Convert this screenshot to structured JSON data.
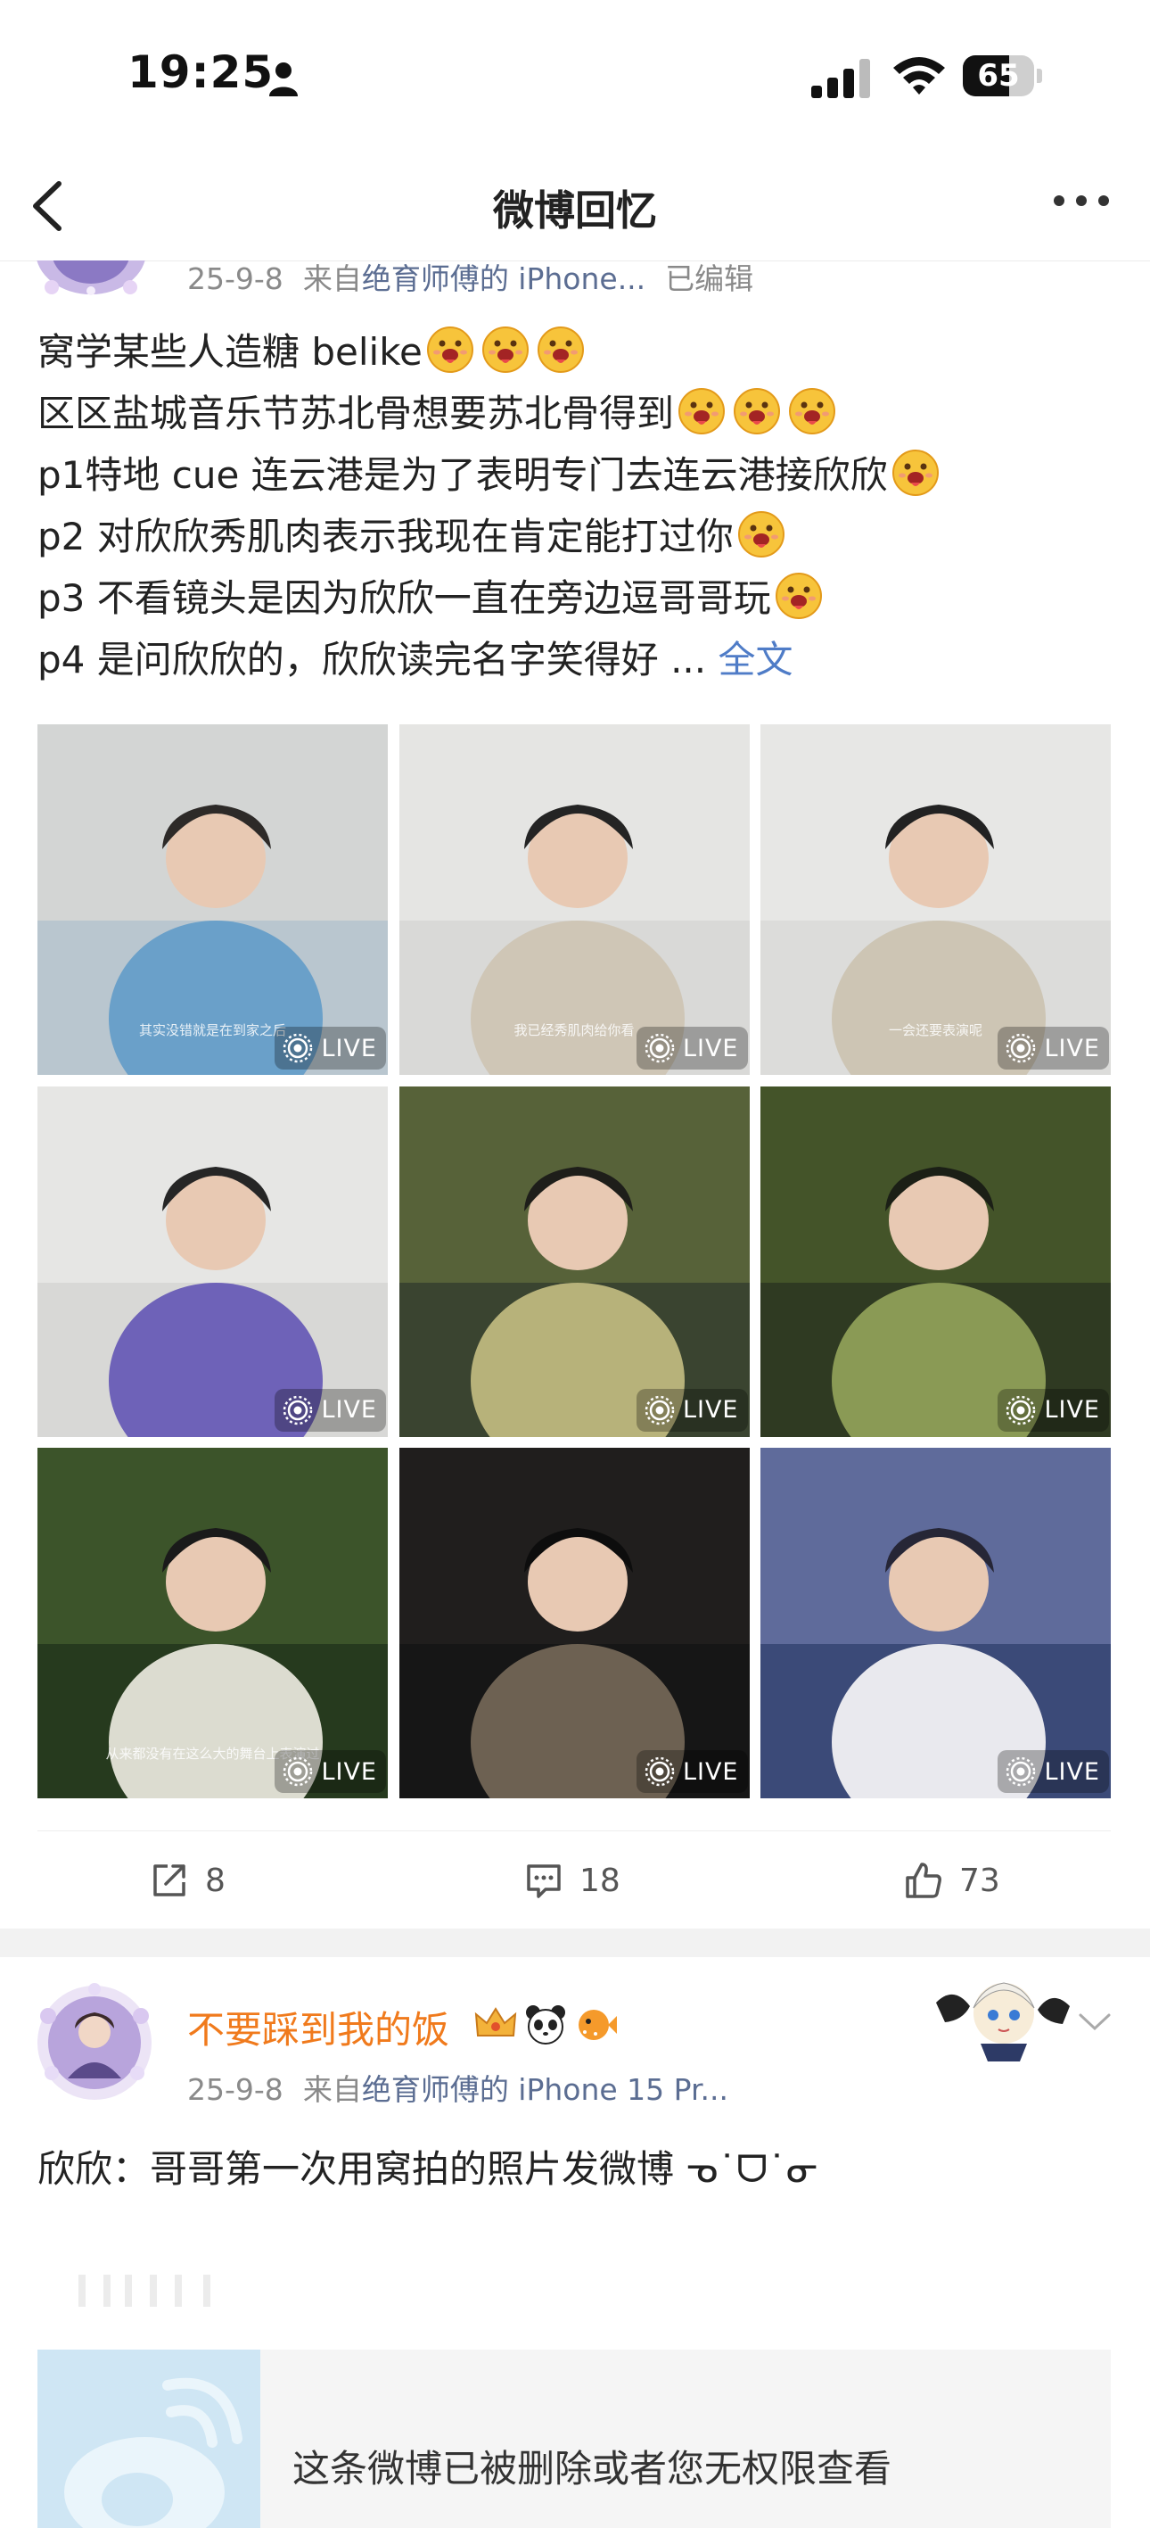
{
  "status_bar": {
    "time": "19:25",
    "battery": "65",
    "battery_level": 0.65
  },
  "nav": {
    "title": "微博回忆"
  },
  "post1": {
    "date": "25-9-8",
    "source_prefix": "来自",
    "source": "绝育师傅的 iPhone...",
    "edited": "已编辑",
    "lines": [
      {
        "text": "窝学某些人造糖 belike",
        "emoji_count": 3
      },
      {
        "text": "区区盐城音乐节苏北骨想要苏北骨得到",
        "emoji_count": 3
      },
      {
        "text": "p1特地 cue 连云港是为了表明专门去连云港接欣欣",
        "emoji_count": 1
      },
      {
        "text": "p2 对欣欣秀肌肉表示我现在肯定能打过你",
        "emoji_count": 1
      },
      {
        "text": "p3 不看镜头是因为欣欣一直在旁边逗哥哥玩",
        "emoji_count": 1
      },
      {
        "text": "p4 是问欣欣的，欣欣读完名字笑得好 ...",
        "emoji_count": 0
      }
    ],
    "full_text_link": "全文",
    "live_label": "LIVE",
    "images": [
      {
        "caption": "其实没错就是在到家之后"
      },
      {
        "caption": "我已经秀肌肉给你看"
      },
      {
        "caption": "一会还要表演呢"
      },
      {
        "caption": ""
      },
      {
        "caption": ""
      },
      {
        "caption": ""
      },
      {
        "caption": "从来都没有在这么大的舞台上表演过"
      },
      {
        "caption": ""
      },
      {
        "caption": ""
      }
    ],
    "reposts": "8",
    "comments": "18",
    "likes": "73"
  },
  "post2": {
    "username": "不要踩到我的饭",
    "date": "25-9-8",
    "source_prefix": "来自",
    "source": "绝育师傅的 iPhone 15 Pr...",
    "text": "欣欣：哥哥第一次用窝拍的照片发微博 ᓀ˙ᗜ˙ᓂ",
    "deleted_notice": "这条微博已被删除或者您无权限查看"
  },
  "colors": {
    "link": "#4f7cc7",
    "username": "#f07a1c",
    "source": "#5b6d92",
    "meta": "#8a8a8a"
  }
}
